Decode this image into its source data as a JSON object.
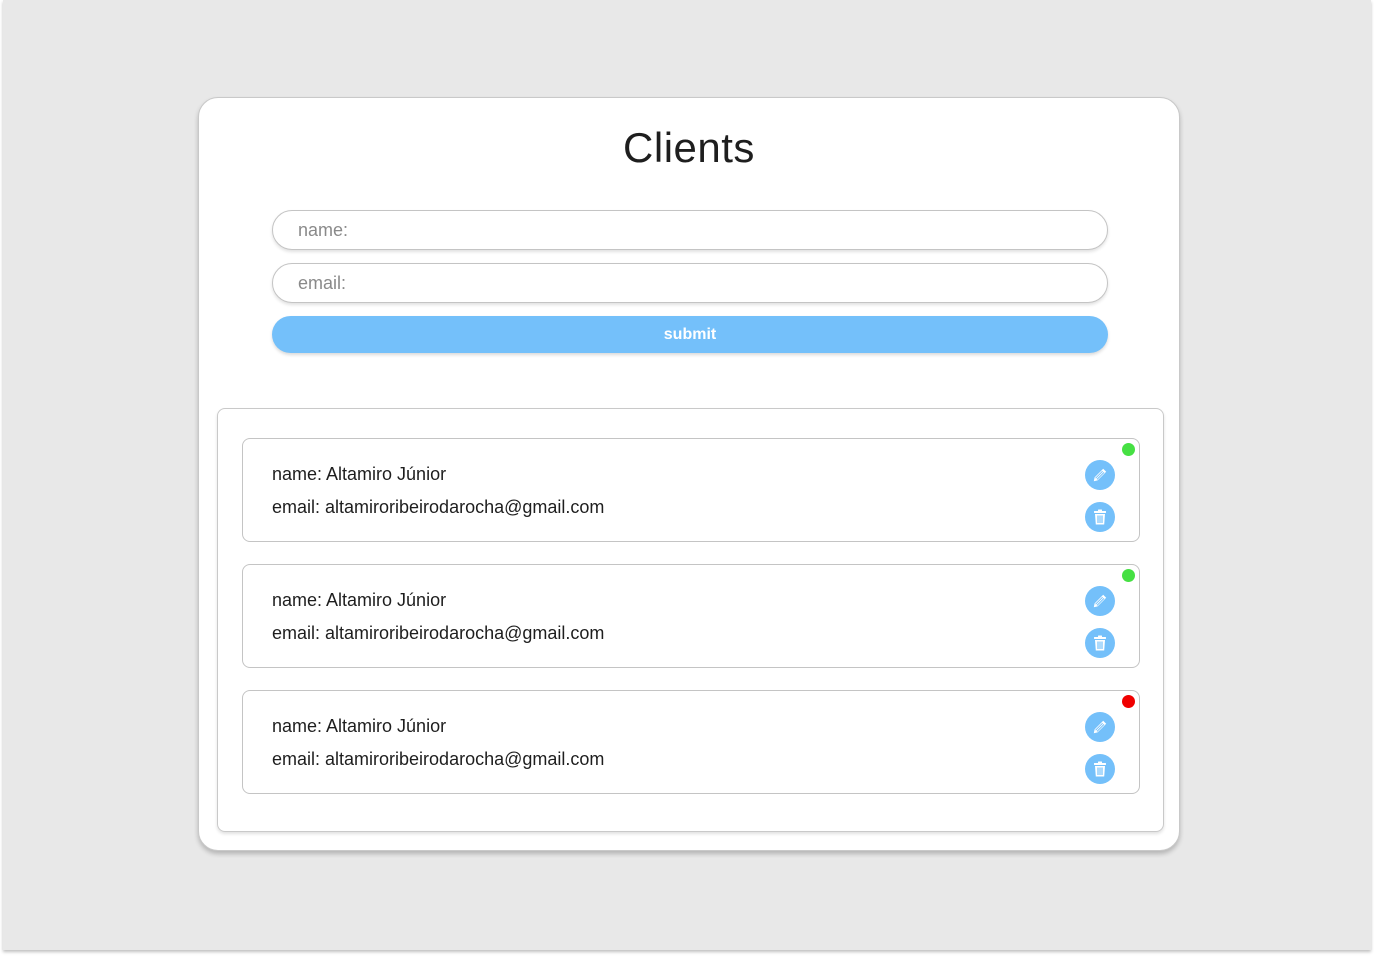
{
  "form": {
    "title": "Clients",
    "name_placeholder": "name:",
    "email_placeholder": "email:",
    "submit_label": "submit"
  },
  "clients": [
    {
      "name_line": "name: Altamiro Júnior",
      "email_line": "email: altamiroribeirodarocha@gmail.com",
      "status_color": "#46e043"
    },
    {
      "name_line": "name: Altamiro Júnior",
      "email_line": "email: altamiroribeirodarocha@gmail.com",
      "status_color": "#46e043"
    },
    {
      "name_line": "name: Altamiro Júnior",
      "email_line": "email: altamiroribeirodarocha@gmail.com",
      "status_color": "#f00000"
    }
  ],
  "icons": {
    "edit": "pencil-icon",
    "delete": "trash-icon"
  },
  "colors": {
    "accent": "#74c0fa",
    "background": "#e8e8e8",
    "status_active": "#46e043",
    "status_inactive": "#f00000"
  }
}
